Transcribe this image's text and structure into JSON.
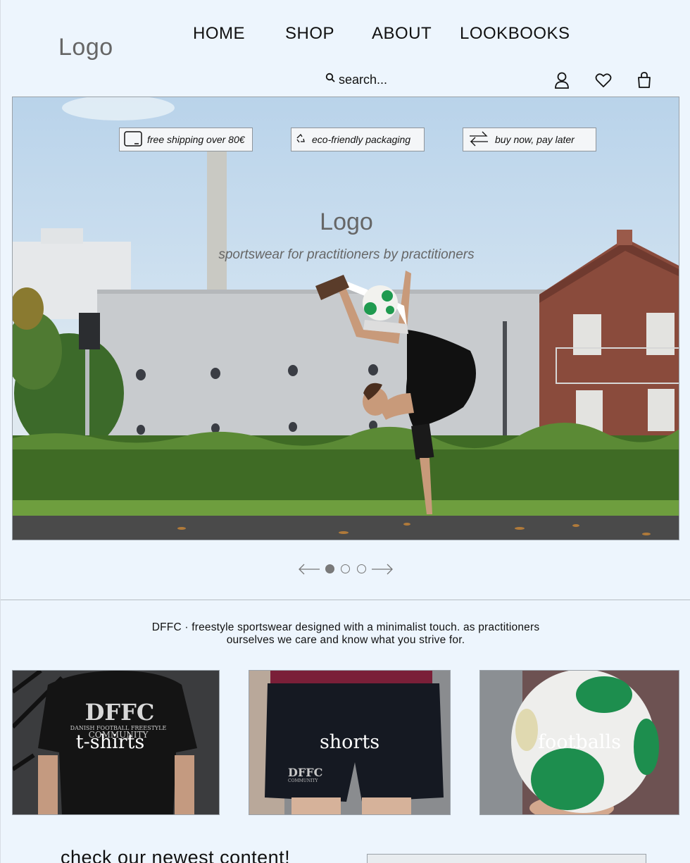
{
  "header": {
    "logo": "Logo",
    "nav": [
      "HOME",
      "SHOP",
      "ABOUT",
      "LOOKBOOKS"
    ],
    "search_placeholder": "search...",
    "icons": [
      "user-icon",
      "heart-icon",
      "bag-icon"
    ]
  },
  "hero": {
    "badges": [
      {
        "icon": "box-icon",
        "label": "free shipping over 80€"
      },
      {
        "icon": "recycle-icon",
        "label": "eco-friendly packaging"
      },
      {
        "icon": "swap-arrows-icon",
        "label": "buy now, pay later"
      }
    ],
    "logo": "Logo",
    "tagline": "sportswear for practitioners by practitioners"
  },
  "carousel": {
    "slides": 3,
    "active_index": 0
  },
  "intro": {
    "text": "DFFC · freestyle sportswear designed with a minimalist touch. as practitioners ourselves we care and know what you strive for."
  },
  "categories": [
    {
      "label": "t-shirts",
      "print": "DFFC",
      "print_sub": "DANISH FOOTBALL FREESTYLE",
      "print_sub2": "COMMUNITY"
    },
    {
      "label": "shorts",
      "print": "DFFC",
      "print_sub": "COMMUNITY"
    },
    {
      "label": "footballs"
    }
  ],
  "newest": {
    "heading": "check our newest content!"
  },
  "colors": {
    "background": "#edf5fd",
    "logo_gray": "#666666"
  }
}
